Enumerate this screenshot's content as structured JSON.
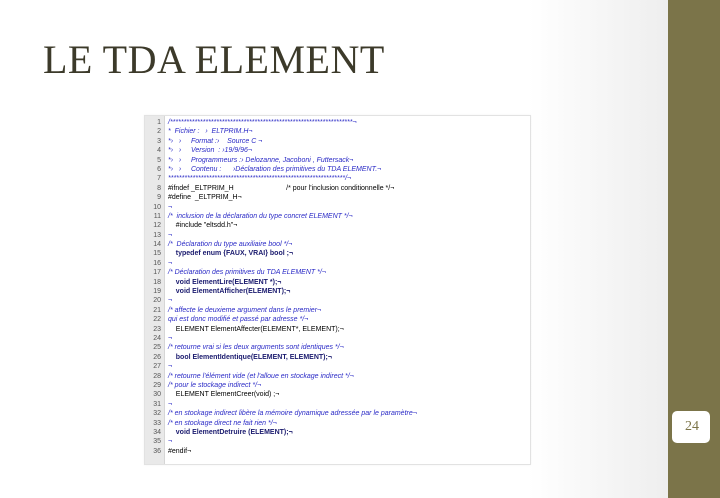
{
  "slide": {
    "title": "LE TDA ELEMENT",
    "page_number": "24"
  },
  "code": {
    "line_numbers": [
      "1",
      "2",
      "3",
      "4",
      "5",
      "6",
      "7",
      "8",
      "9",
      "10",
      "11",
      "12",
      "13",
      "14",
      "15",
      "16",
      "17",
      "18",
      "19",
      "20",
      "21",
      "22",
      "23",
      "24",
      "25",
      "26",
      "27",
      "28",
      "29",
      "30",
      "31",
      "32",
      "33",
      "34",
      "35",
      "36"
    ],
    "lines": [
      {
        "cls": "comment",
        "text": "/*******************************************************************¬"
      },
      {
        "cls": "comment",
        "text": "*  Fichier :   ›  ELTPRIM.H¬"
      },
      {
        "cls": "comment",
        "text": "*›   ›     Format :›    Source C ¬"
      },
      {
        "cls": "comment",
        "text": "*›   ›     Version  : ›19/9/96¬"
      },
      {
        "cls": "comment",
        "text": "*›   ›     Programmeurs :› Delozanne, Jacoboni , Futtersack¬"
      },
      {
        "cls": "comment",
        "text": "*›   ›     Contenu :      ›Déclaration des primitives du TDA ELEMENT.¬"
      },
      {
        "cls": "comment",
        "text": "*****************************************************************/¬"
      },
      {
        "cls": "directive",
        "text": "#ifndef _ELTPRIM_H                           /* pour l'inclusion conditionnelle */¬"
      },
      {
        "cls": "directive",
        "text": "#define  _ELTPRIM_H¬"
      },
      {
        "cls": "comment",
        "text": "¬"
      },
      {
        "cls": "comment",
        "text": "/*  inclusion de la déclaration du type concret ELEMENT */¬"
      },
      {
        "cls": "directive",
        "text": "    #include \"eltsdd.h\"¬"
      },
      {
        "cls": "comment",
        "text": "¬"
      },
      {
        "cls": "comment",
        "text": "/*  Déclaration du type auxiliaire bool */¬"
      },
      {
        "cls": "kw",
        "text": "    typedef enum {FAUX, VRAI} bool ;¬"
      },
      {
        "cls": "comment",
        "text": "¬"
      },
      {
        "cls": "comment",
        "text": "/* Déclaration des primitives du TDA ELEMENT */¬"
      },
      {
        "cls": "kw",
        "text": "    void ElementLire(ELEMENT *);¬"
      },
      {
        "cls": "kw",
        "text": "    void ElementAfficher(ELEMENT);¬"
      },
      {
        "cls": "comment",
        "text": "¬"
      },
      {
        "cls": "comment",
        "text": "/* affecte le deuxieme argument dans le premier¬"
      },
      {
        "cls": "comment",
        "text": "qui est donc modifié et passé par adresse */¬"
      },
      {
        "cls": "directive",
        "text": "    ELEMENT ElementAffecter(ELEMENT*, ELEMENT);¬"
      },
      {
        "cls": "comment",
        "text": "¬"
      },
      {
        "cls": "comment",
        "text": "/* retourne vrai si les deux arguments sont identiques */¬"
      },
      {
        "cls": "kw",
        "text": "    bool ElementIdentique(ELEMENT, ELEMENT);¬"
      },
      {
        "cls": "comment",
        "text": "¬"
      },
      {
        "cls": "comment",
        "text": "/* retourne l'élément vide (et l'alloue en stockage indirect */¬"
      },
      {
        "cls": "comment",
        "text": "/* pour le stockage indirect */¬"
      },
      {
        "cls": "directive",
        "text": "    ELEMENT ElementCreer(void) ;¬"
      },
      {
        "cls": "comment",
        "text": "¬"
      },
      {
        "cls": "comment",
        "text": "/* en stockage indirect libère la mémoire dynamique adressée par le paramètre¬"
      },
      {
        "cls": "comment",
        "text": "/* en stockage direct ne fait rien */¬"
      },
      {
        "cls": "kw",
        "text": "    void ElementDetruire (ELEMENT);¬"
      },
      {
        "cls": "comment",
        "text": "¬"
      },
      {
        "cls": "directive",
        "text": "#endif¬"
      }
    ]
  }
}
